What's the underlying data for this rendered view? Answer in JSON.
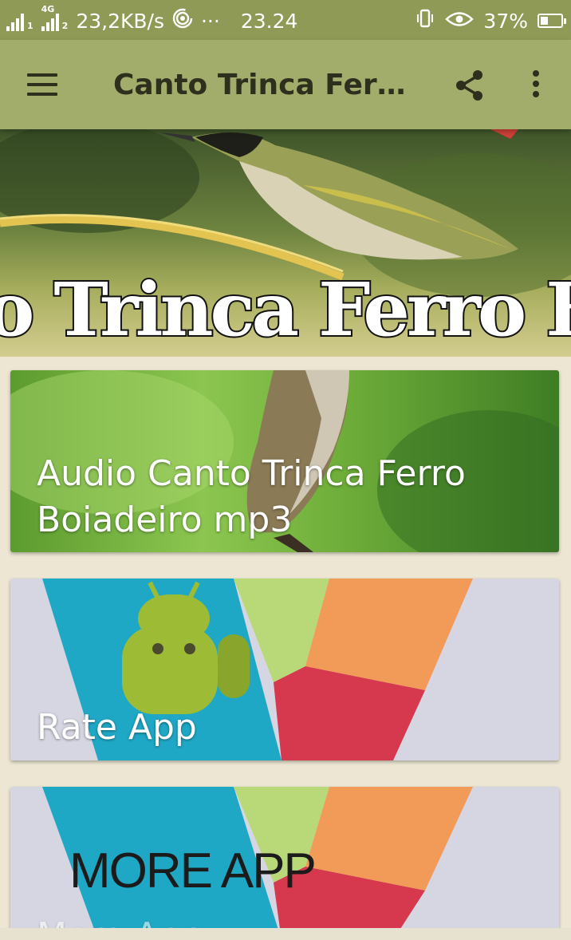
{
  "status_bar": {
    "sim1": "1",
    "network": "4G",
    "sim2": "2",
    "speed": "23,2KB/s",
    "dots": "···",
    "time": "23.24",
    "battery_percent": "37%",
    "battery_level": 0.37
  },
  "app_bar": {
    "title": "Canto Trinca Ferro Boiadeiro"
  },
  "banner": {
    "text": "o Trinca Ferro Boiadeiro"
  },
  "cards": [
    {
      "label": "Audio Canto Trinca Ferro Boiadeiro mp3"
    },
    {
      "label": "Rate App"
    },
    {
      "label": "More App",
      "image_text": "MORE APP"
    }
  ],
  "colors": {
    "status_bar": "#8f9a57",
    "app_bar": "#a3ad6b",
    "app_bar_text": "#2e2f1d",
    "background": "#ece6d3"
  }
}
